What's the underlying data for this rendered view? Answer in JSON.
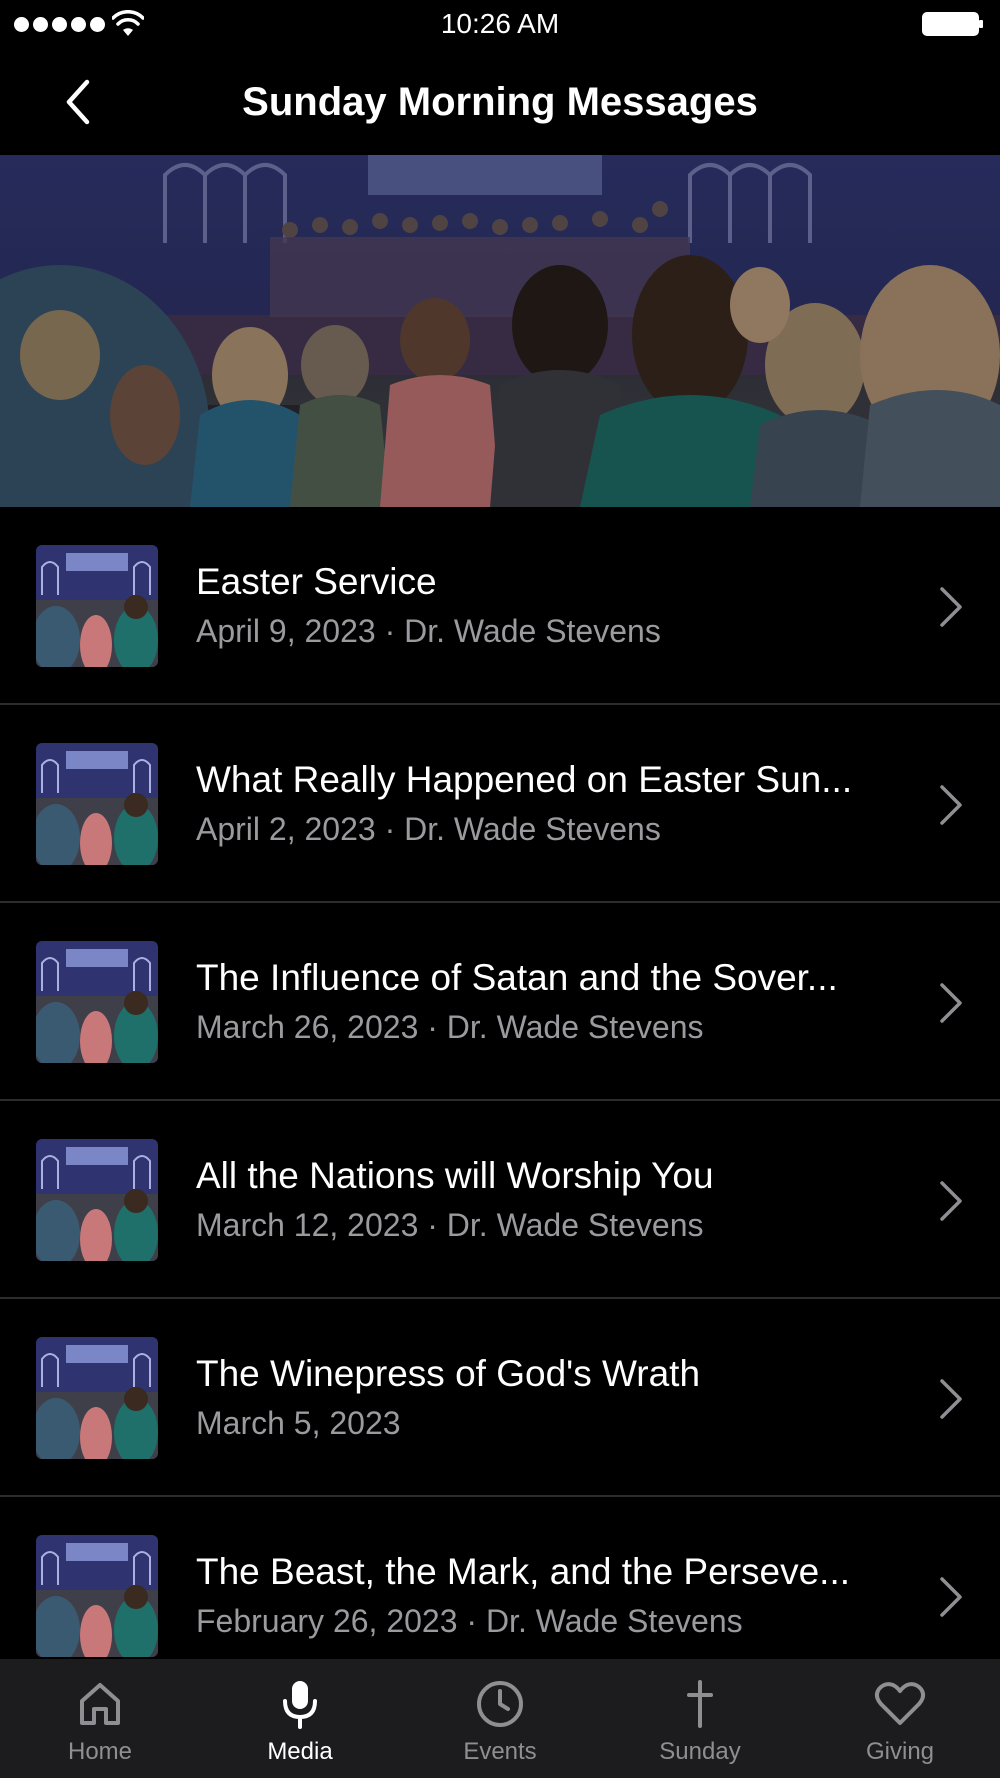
{
  "status_bar": {
    "time": "10:26 AM"
  },
  "nav": {
    "title": "Sunday Morning Messages"
  },
  "messages": [
    {
      "title": "Easter Service",
      "subtitle": "April 9, 2023 · Dr. Wade Stevens"
    },
    {
      "title": "What Really Happened on Easter Sun...",
      "subtitle": "April 2, 2023 · Dr. Wade Stevens"
    },
    {
      "title": "The Influence of Satan and the Sover...",
      "subtitle": "March 26, 2023 · Dr. Wade Stevens"
    },
    {
      "title": "All the Nations will Worship You",
      "subtitle": "March 12, 2023 · Dr. Wade Stevens"
    },
    {
      "title": "The Winepress of God's Wrath",
      "subtitle": "March 5, 2023"
    },
    {
      "title": "The Beast, the Mark, and the Perseve...",
      "subtitle": "February 26, 2023 · Dr. Wade Stevens"
    }
  ],
  "tabs": [
    {
      "label": "Home",
      "icon": "home-icon"
    },
    {
      "label": "Media",
      "icon": "microphone-icon",
      "active": true
    },
    {
      "label": "Events",
      "icon": "clock-icon"
    },
    {
      "label": "Sunday",
      "icon": "cross-icon"
    },
    {
      "label": "Giving",
      "icon": "heart-icon"
    }
  ],
  "colors": {
    "background": "#000000",
    "tab_bar": "#1c1c1e",
    "secondary_text": "#9a9a9f",
    "inactive_tab": "#8e8e93"
  }
}
